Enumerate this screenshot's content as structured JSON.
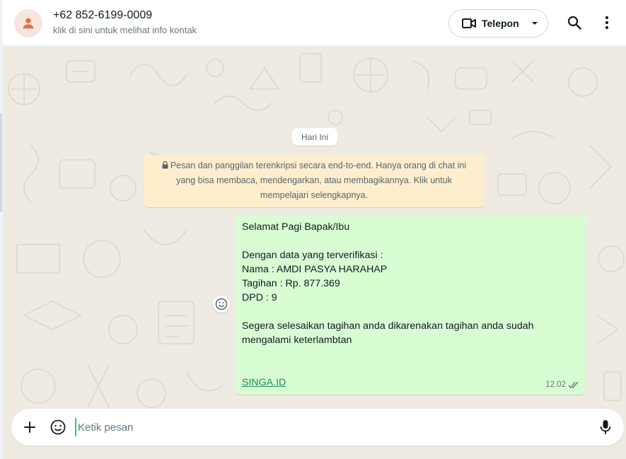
{
  "header": {
    "contact_name": "+62 852-6199-0009",
    "contact_subtitle": "klik di sini untuk melihat info kontak",
    "call_label": "Telepon",
    "icons": [
      "avatar-icon",
      "video-icon",
      "dropdown-icon",
      "search-icon",
      "menu-icon"
    ]
  },
  "chat": {
    "date_chip": "Hari Ini",
    "encryption_notice": "Pesan dan panggilan terenkripsi secara end-to-end. Hanya orang di chat ini yang bisa membaca, mendengarkan, atau membagikannya. Klik untuk mempelajari selengkapnya.",
    "message": {
      "lines": [
        "Selamat Pagi Bapak/Ibu",
        "",
        "Dengan data yang terverifikasi :",
        "Nama : AMDI PASYA HARAHAP",
        "Tagihan : Rp. 877.369",
        "DPD : 9",
        "",
        "Segera selesaikan tagihan anda dikarenakan tagihan anda sudah",
        "mengalami keterlambtan",
        "",
        ""
      ],
      "link_text": "SINGA.ID",
      "time": "12.02",
      "status": "delivered"
    }
  },
  "composer": {
    "placeholder": "Ketik pesan",
    "icons": [
      "plus-icon",
      "sticker-icon",
      "microphone-icon"
    ]
  },
  "colors": {
    "chat_bg": "#efeae2",
    "outgoing_bubble": "#d9fdd3",
    "notice_bg": "#ffeecd",
    "accent": "#25d366"
  }
}
